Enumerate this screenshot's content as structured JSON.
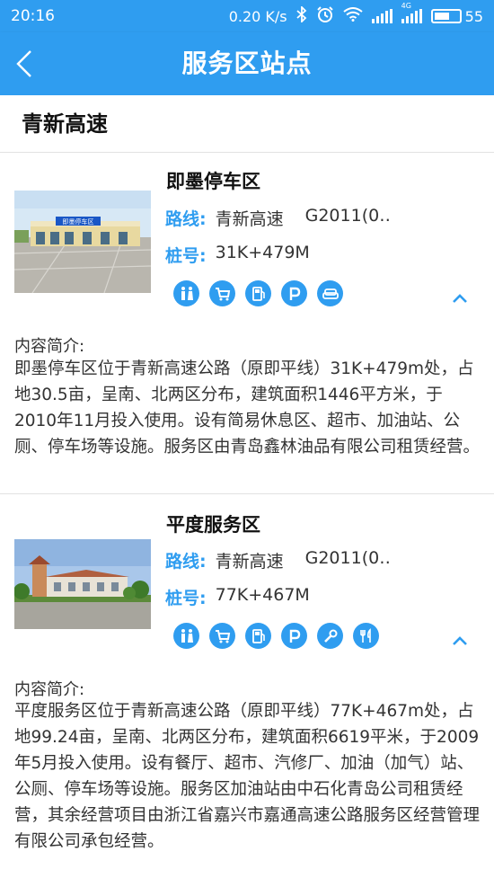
{
  "status_bar": {
    "time": "20:16",
    "speed": "0.20 K/s",
    "network": "4G",
    "battery": "55"
  },
  "header": {
    "title": "服务区站点"
  },
  "section": {
    "title": "青新高速"
  },
  "cards": [
    {
      "name": "即墨停车区",
      "route_label": "路线:",
      "route": "青新高速",
      "route_code": "G2011(0‥",
      "stake_label": "桩号:",
      "stake": "31K+479M",
      "facilities": [
        "restroom-icon",
        "shopping-cart-icon",
        "fuel-icon",
        "parking-icon",
        "sofa-icon"
      ],
      "intro_label": "内容简介:",
      "intro": "即墨停车区位于青新高速公路（原即平线）31K+479m处，占地30.5亩，呈南、北两区分布，建筑面积1446平方米，于2010年11月投入使用。设有简易休息区、超市、加油站、公厕、停车场等设施。服务区由青岛鑫林油品有限公司租赁经营。",
      "thumb_sign": "即墨停车区"
    },
    {
      "name": "平度服务区",
      "route_label": "路线:",
      "route": "青新高速",
      "route_code": "G2011(0‥",
      "stake_label": "桩号:",
      "stake": "77K+467M",
      "facilities": [
        "restroom-icon",
        "shopping-cart-icon",
        "fuel-icon",
        "parking-icon",
        "wrench-icon",
        "restaurant-icon"
      ],
      "intro_label": "内容简介:",
      "intro": "平度服务区位于青新高速公路（原即平线）77K+467m处，占地99.24亩，呈南、北两区分布，建筑面积6619平米，于2009年5月投入使用。设有餐厅、超市、汽修厂、加油（加气）站、公厕、停车场等设施。服务区加油站由中石化青岛公司租赁经营，其余经营项目由浙江省嘉兴市嘉通高速公路服务区经营管理有限公司承包经营。"
    }
  ]
}
